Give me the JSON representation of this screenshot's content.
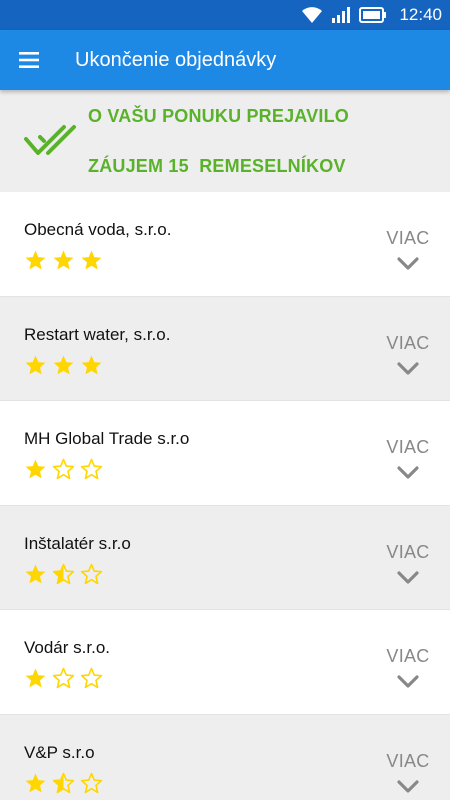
{
  "status_bar": {
    "time": "12:40",
    "icons": [
      "wifi-icon",
      "signal-icon",
      "battery-icon"
    ]
  },
  "app_bar": {
    "title": "Ukončenie objednávky",
    "menu_icon": "menu-icon"
  },
  "banner": {
    "icon": "double-check-icon",
    "line1": "O VAŠU PONUKU PREJAVILO",
    "line2": "ZÁUJEM 15  REMESELNÍKOV"
  },
  "colors": {
    "status_bar": "#1565c0",
    "app_bar": "#1e88e5",
    "accent_green": "#5ab22b",
    "star_yellow": "#ffd600"
  },
  "craftsmen": [
    {
      "name": "Obecná voda, s.r.o.",
      "rating": 3,
      "more": "VIAC"
    },
    {
      "name": "Restart water, s.r.o.",
      "rating": 3,
      "more": "VIAC"
    },
    {
      "name": "MH Global Trade s.r.o",
      "rating": 1,
      "more": "VIAC"
    },
    {
      "name": "Inštalatér s.r.o",
      "rating": 1.5,
      "more": "VIAC"
    },
    {
      "name": "Vodár s.r.o.",
      "rating": 1,
      "more": "VIAC"
    },
    {
      "name": "V&P s.r.o",
      "rating": 1.5,
      "more": "VIAC"
    }
  ]
}
